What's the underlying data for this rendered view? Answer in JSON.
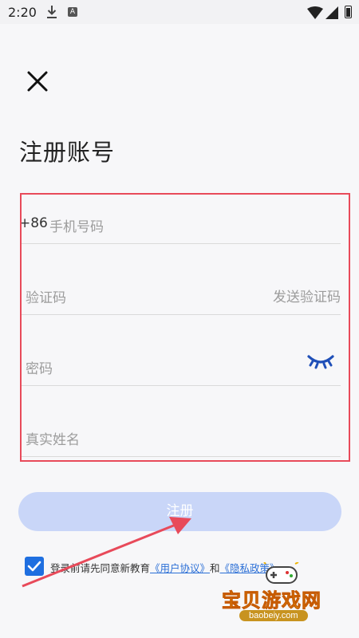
{
  "status_bar": {
    "time": "2:20",
    "a_badge": "A"
  },
  "page_title": "注册账号",
  "form": {
    "country_code": "+86",
    "phone_placeholder": "手机号码",
    "code_placeholder": "验证码",
    "send_code_label": "发送验证码",
    "password_placeholder": "密码",
    "realname_placeholder": "真实姓名"
  },
  "register_label": "注册",
  "agreement": {
    "checked": true,
    "prefix": "登录前请先同意新教育",
    "user_agreement": "《用户协议》",
    "and": "和",
    "privacy_policy": "《隐私政策》"
  },
  "watermark": {
    "title": "宝贝游戏网",
    "url": "baobeiy.com"
  },
  "colors": {
    "accent": "#1f6fe0",
    "highlight": "#e84a5a",
    "button_disabled": "#c9d6f8"
  }
}
